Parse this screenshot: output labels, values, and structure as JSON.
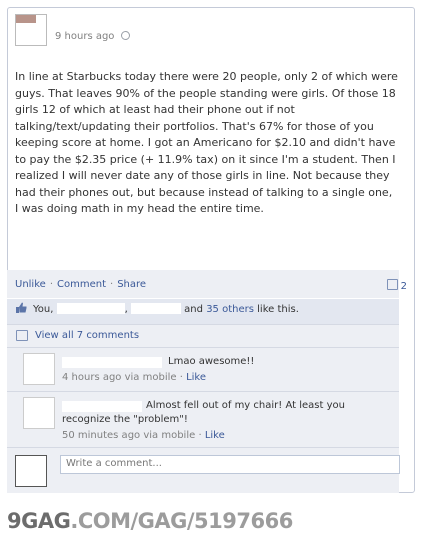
{
  "post": {
    "time": "9 hours ago",
    "body": "In line at Starbucks today there were 20 people, only 2 of which were guys. That leaves 90% of the people standing were girls. Of those 18 girls 12 of which at least had their phone out if not talking/text/updating their portfolios. That's 67% for those of you keeping score at home. I got an Americano for $2.10 and didn't have to pay the $2.35 price (+ 11.9% tax) on it since I'm a student. Then I realized I will never date any of those girls in line. Not because they had their phones out, but because instead of talking to a single one, I was doing math in my head the entire time."
  },
  "actions": {
    "unlike": "Unlike",
    "comment": "Comment",
    "share": "Share",
    "comment_count": "2"
  },
  "likes": {
    "prefix": "You,",
    "comma": ",",
    "and": "and",
    "others_link": "35 others",
    "suffix": "like this."
  },
  "view_all": "View all 7 comments",
  "comments": [
    {
      "text": "Lmao awesome!!",
      "time": "4 hours ago via mobile",
      "like": "Like"
    },
    {
      "text": "Almost fell out of my chair! At least you recognize the \"problem\"!",
      "time": "50 minutes ago via mobile",
      "like": "Like"
    }
  ],
  "write_placeholder": "Write a comment...",
  "watermark": {
    "brand": "9GAG",
    "path": ".COM/GAG/5197666"
  }
}
